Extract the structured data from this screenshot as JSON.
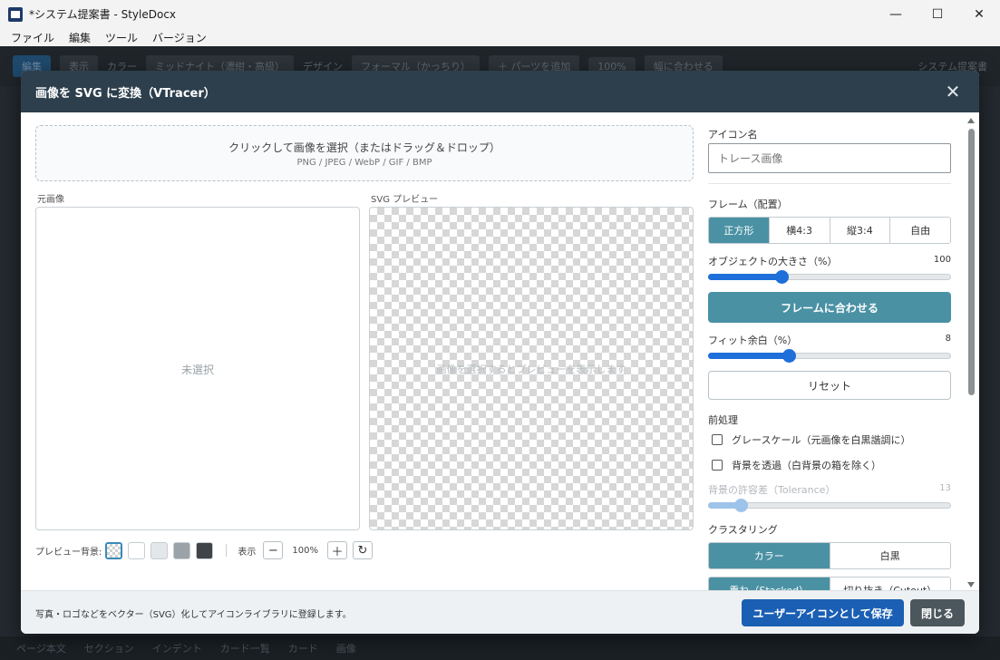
{
  "window": {
    "title": "*システム提案書 - StyleDocx",
    "minimize": "—",
    "maximize": "☐",
    "close": "✕"
  },
  "menu": [
    "ファイル",
    "編集",
    "ツール",
    "バージョン"
  ],
  "background": {
    "tabs": [
      "編集",
      "表示"
    ],
    "color_label": "カラー",
    "color_value": "ミッドナイト（濃紺・高級）",
    "design_label": "デザイン",
    "design_value": "フォーマル（かっちり）",
    "add_part": "＋ パーツを追加",
    "zoom": "100%",
    "fit_width": "幅に合わせる",
    "doc_name": "システム提案書",
    "bottom_tabs": [
      "ページ本文",
      "セクション",
      "インデント",
      "カード一覧",
      "カード",
      "画像"
    ]
  },
  "modal": {
    "title": "画像を SVG に変換（VTracer）",
    "close_icon": "✕",
    "dropzone": {
      "main": "クリックして画像を選択（またはドラッグ＆ドロップ）",
      "sub": "PNG / JPEG / WebP / GIF / BMP"
    },
    "source_label": "元画像",
    "source_empty": "未選択",
    "svg_label": "SVG プレビュー",
    "svg_empty": "画像を選択するとプレビューを表示します",
    "preview_bg_label": "プレビュー背景:",
    "swatches": [
      "#ffffff",
      "#e4e7ea",
      "#9ca3a8",
      "#404449"
    ],
    "view_label": "表示",
    "zoom_minus": "−",
    "zoom_value": "100%",
    "zoom_plus": "＋",
    "reset_icon": "↻",
    "right": {
      "icon_name_label": "アイコン名",
      "icon_name_placeholder": "トレース画像",
      "frame_label": "フレーム（配置）",
      "frame_options": [
        "正方形",
        "横4:3",
        "縦3:4",
        "自由"
      ],
      "object_size_label": "オブジェクトの大きさ（%）",
      "object_size_value": "100",
      "object_size_level": 0.3,
      "fit_frame_button": "フレームに合わせる",
      "fit_margin_label": "フィット余白（%）",
      "fit_margin_value": "8",
      "fit_margin_level": 0.33,
      "reset_button": "リセット",
      "preprocess_label": "前処理",
      "grayscale_label": "グレースケール（元画像を白黒諧調に）",
      "transparent_label": "背景を透過（白背景の箱を除く）",
      "tolerance_label": "背景の許容差（Tolerance）",
      "tolerance_value": "13",
      "tolerance_level": 0.13,
      "clustering_label": "クラスタリング",
      "clustering_options": [
        "カラー",
        "白黒"
      ],
      "next_options": [
        "重ね（Stacked）",
        "切り抜き（Cutout）"
      ]
    },
    "footer": {
      "note": "写真・ロゴなどをベクター（SVG）化してアイコンライブラリに登録します。",
      "save_button": "ユーザーアイコンとして保存",
      "close_button": "閉じる"
    }
  },
  "colors": {
    "accent": "#4a91a4",
    "primary": "#1a5fb4",
    "header": "#2d3f4c"
  }
}
